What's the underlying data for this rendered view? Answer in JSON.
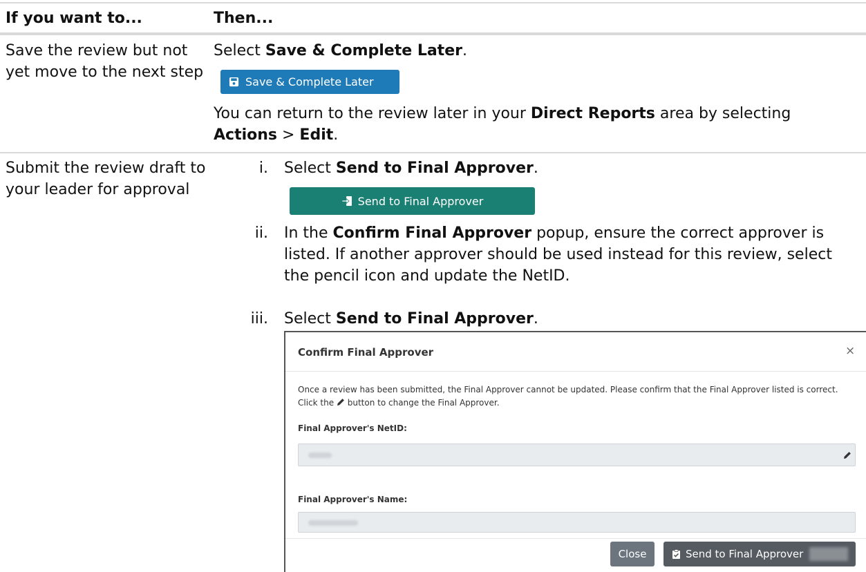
{
  "table": {
    "header": {
      "col1": "If you want to...",
      "col2": "Then..."
    },
    "rows": [
      {
        "if": "Save the review but not yet move to the next step",
        "then_prefix": "Select ",
        "then_bold": "Save & Complete Later",
        "then_suffix": ".",
        "button_label": "Save & Complete Later",
        "note_prefix": "You can return to the review later in your ",
        "note_bold1": "Direct Reports",
        "note_mid": " area by selecting ",
        "note_bold2": "Actions",
        "note_sep": " > ",
        "note_bold3": "Edit",
        "note_suffix": "."
      },
      {
        "if": "Submit the review draft to your leader for approval",
        "steps": [
          {
            "num": "i.",
            "prefix": "Select ",
            "bold": "Send to Final Approver",
            "suffix": "."
          },
          {
            "num": "ii.",
            "prefix": "In the ",
            "bold": "Confirm Final Approver",
            "suffix": " popup, ensure the correct approver is listed. If another approver should be used instead for this review, select the pencil icon and update the NetID."
          },
          {
            "num": "iii.",
            "prefix": "Select ",
            "bold": "Send to Final Approver",
            "suffix": "."
          }
        ],
        "button_label": "Send to Final Approver"
      }
    ]
  },
  "modal": {
    "title": "Confirm Final Approver",
    "close_glyph": "×",
    "message_line1": "Once a review has been submitted, the Final Approver cannot be updated. Please confirm that the Final Approver listed is correct.",
    "message_line2_prefix": "Click the ",
    "message_line2_suffix": " button to change the Final Approver.",
    "netid_label": "Final Approver's NetID:",
    "name_label": "Final Approver's Name:",
    "close_button": "Close",
    "send_button": "Send to Final Approver"
  },
  "icons": {
    "save": "floppy-disk-icon",
    "send": "sign-in-arrow-icon",
    "pencil": "pencil-icon",
    "clipboard": "clipboard-check-icon"
  },
  "colors": {
    "save_button": "#1f7bb8",
    "send_button": "#1a8073",
    "close_button": "#6c757d",
    "modal_send_button": "#555b61"
  }
}
